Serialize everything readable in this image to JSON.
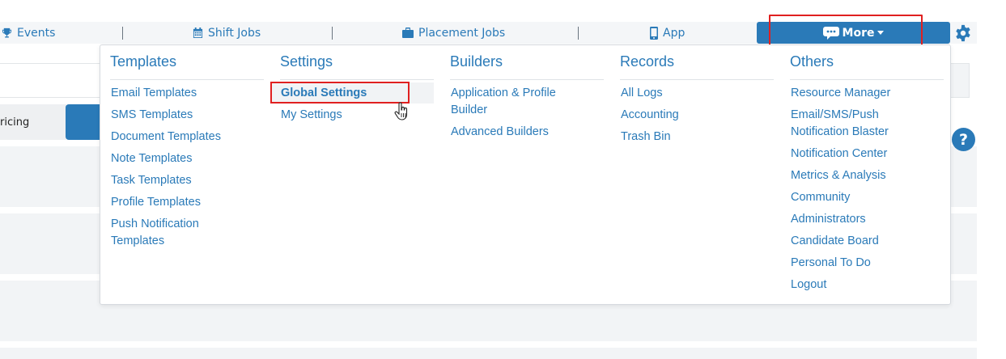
{
  "topnav": {
    "events": "Events",
    "shift_jobs": "Shift Jobs",
    "placement_jobs": "Placement Jobs",
    "app": "App",
    "more": "More"
  },
  "page": {
    "pricing_tab": "ricing"
  },
  "dropdown": {
    "columns": [
      {
        "heading": "Templates",
        "links": [
          "Email Templates",
          "SMS Templates",
          "Document Templates",
          "Note Templates",
          "Task Templates",
          "Profile Templates",
          "Push Notification\nTemplates"
        ]
      },
      {
        "heading": "Settings",
        "links": [
          "Global Settings",
          "My Settings"
        ]
      },
      {
        "heading": "Builders",
        "links": [
          "Application & Profile\nBuilder",
          "Advanced Builders"
        ]
      },
      {
        "heading": "Records",
        "links": [
          "All Logs",
          "Accounting",
          "Trash Bin"
        ]
      },
      {
        "heading": "Others",
        "links": [
          "Resource Manager",
          "Email/SMS/Push\nNotification Blaster",
          "Notification Center",
          "Metrics & Analysis",
          "Community",
          "Administrators",
          "Candidate Board",
          "Personal To Do",
          "Logout"
        ]
      }
    ]
  },
  "help": "?",
  "colors": {
    "accent": "#2a7ab8",
    "highlight": "#e02020"
  },
  "icons": [
    "trophy-icon",
    "calendar-icon",
    "briefcase-icon",
    "mobile-icon",
    "chat-icon",
    "caret-down-icon",
    "gear-icon",
    "help-icon",
    "hand-cursor-icon"
  ]
}
